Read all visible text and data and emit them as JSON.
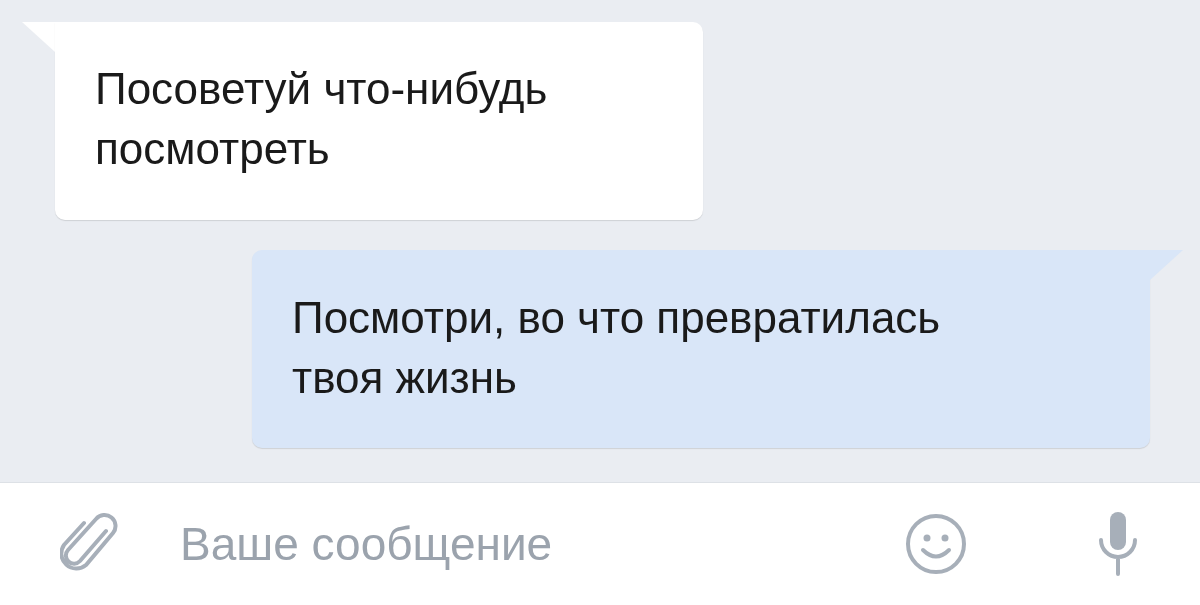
{
  "messages": [
    {
      "kind": "incoming",
      "text": "Посоветуй что-нибудь посмотреть"
    },
    {
      "kind": "outgoing",
      "text": "Посмотри, во что превратилась твоя жизнь"
    }
  ],
  "composer": {
    "placeholder": "Ваше сообщение"
  }
}
